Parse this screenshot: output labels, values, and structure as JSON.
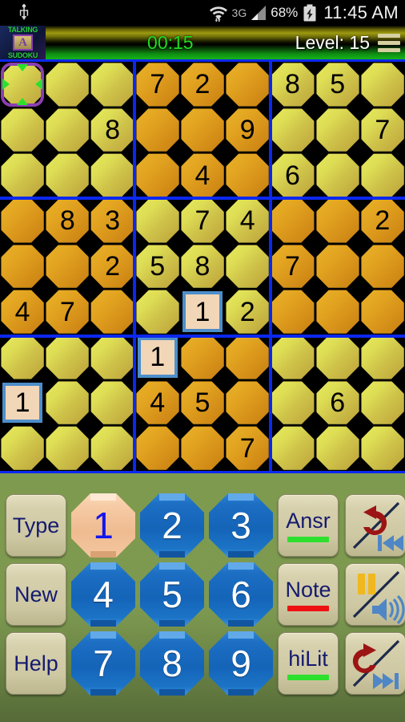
{
  "status_bar": {
    "usb_icon": "usb-icon",
    "wifi_icon": "wifi-icon",
    "network": "3G",
    "signal_icon": "signal-bars-icon",
    "battery_percent": "68%",
    "battery_icon": "battery-charging-icon",
    "clock": "11:45 AM"
  },
  "header": {
    "logo_top": "TALKING",
    "logo_letter": "A",
    "logo_bottom": "SUDOKU",
    "timer": "00:15",
    "level": "Level: 15",
    "menu_icon": "hamburger-menu-icon",
    "timer_color": "#1fdd1f",
    "level_color": "#ffffff"
  },
  "board": {
    "grid_line_color": "#0b28f0",
    "cell_light_color": "#dede55",
    "cell_dark_color": "#e3a521",
    "user_value_fill": "#f2d6b8",
    "user_value_border": "#4d8ecb",
    "cursor_border_color": "#8a3fb0",
    "cursor_arrow_color": "#2ce02c",
    "cursor_row": 0,
    "cursor_col": 0,
    "rows": [
      [
        {
          "v": "",
          "t": "empty"
        },
        {
          "v": "",
          "t": "empty"
        },
        {
          "v": "",
          "t": "empty"
        },
        {
          "v": "7",
          "t": "given"
        },
        {
          "v": "2",
          "t": "given"
        },
        {
          "v": "",
          "t": "empty"
        },
        {
          "v": "8",
          "t": "given"
        },
        {
          "v": "5",
          "t": "given"
        },
        {
          "v": "",
          "t": "empty"
        }
      ],
      [
        {
          "v": "",
          "t": "empty"
        },
        {
          "v": "",
          "t": "empty"
        },
        {
          "v": "8",
          "t": "given"
        },
        {
          "v": "",
          "t": "empty"
        },
        {
          "v": "",
          "t": "empty"
        },
        {
          "v": "9",
          "t": "given"
        },
        {
          "v": "",
          "t": "empty"
        },
        {
          "v": "",
          "t": "empty"
        },
        {
          "v": "7",
          "t": "given"
        }
      ],
      [
        {
          "v": "",
          "t": "empty"
        },
        {
          "v": "",
          "t": "empty"
        },
        {
          "v": "",
          "t": "empty"
        },
        {
          "v": "",
          "t": "empty"
        },
        {
          "v": "4",
          "t": "given"
        },
        {
          "v": "",
          "t": "empty"
        },
        {
          "v": "6",
          "t": "given"
        },
        {
          "v": "",
          "t": "empty"
        },
        {
          "v": "",
          "t": "empty"
        }
      ],
      [
        {
          "v": "",
          "t": "empty"
        },
        {
          "v": "8",
          "t": "given"
        },
        {
          "v": "3",
          "t": "given"
        },
        {
          "v": "",
          "t": "empty"
        },
        {
          "v": "7",
          "t": "given"
        },
        {
          "v": "4",
          "t": "given"
        },
        {
          "v": "",
          "t": "empty"
        },
        {
          "v": "",
          "t": "empty"
        },
        {
          "v": "2",
          "t": "given"
        }
      ],
      [
        {
          "v": "",
          "t": "empty"
        },
        {
          "v": "",
          "t": "empty"
        },
        {
          "v": "2",
          "t": "given"
        },
        {
          "v": "5",
          "t": "given"
        },
        {
          "v": "8",
          "t": "given"
        },
        {
          "v": "",
          "t": "empty"
        },
        {
          "v": "7",
          "t": "given"
        },
        {
          "v": "",
          "t": "empty"
        },
        {
          "v": "",
          "t": "empty"
        }
      ],
      [
        {
          "v": "4",
          "t": "given"
        },
        {
          "v": "7",
          "t": "given"
        },
        {
          "v": "",
          "t": "empty"
        },
        {
          "v": "",
          "t": "empty"
        },
        {
          "v": "1",
          "t": "user"
        },
        {
          "v": "2",
          "t": "given"
        },
        {
          "v": "",
          "t": "empty"
        },
        {
          "v": "",
          "t": "empty"
        },
        {
          "v": "",
          "t": "empty"
        }
      ],
      [
        {
          "v": "",
          "t": "empty"
        },
        {
          "v": "",
          "t": "empty"
        },
        {
          "v": "",
          "t": "empty"
        },
        {
          "v": "1",
          "t": "user"
        },
        {
          "v": "",
          "t": "empty"
        },
        {
          "v": "",
          "t": "empty"
        },
        {
          "v": "",
          "t": "empty"
        },
        {
          "v": "",
          "t": "empty"
        },
        {
          "v": "",
          "t": "empty"
        }
      ],
      [
        {
          "v": "1",
          "t": "user"
        },
        {
          "v": "",
          "t": "empty"
        },
        {
          "v": "",
          "t": "empty"
        },
        {
          "v": "4",
          "t": "given"
        },
        {
          "v": "5",
          "t": "given"
        },
        {
          "v": "",
          "t": "empty"
        },
        {
          "v": "",
          "t": "empty"
        },
        {
          "v": "6",
          "t": "given"
        },
        {
          "v": "",
          "t": "empty"
        }
      ],
      [
        {
          "v": "",
          "t": "empty"
        },
        {
          "v": "",
          "t": "empty"
        },
        {
          "v": "",
          "t": "empty"
        },
        {
          "v": "",
          "t": "empty"
        },
        {
          "v": "",
          "t": "empty"
        },
        {
          "v": "7",
          "t": "given"
        },
        {
          "v": "",
          "t": "empty"
        },
        {
          "v": "",
          "t": "empty"
        },
        {
          "v": "",
          "t": "empty"
        }
      ]
    ]
  },
  "panel": {
    "background_color": "#7d9950",
    "function_buttons": [
      {
        "label": "Type",
        "bar": null
      },
      {
        "label": "New",
        "bar": null
      },
      {
        "label": "Help",
        "bar": null
      }
    ],
    "mode_buttons": [
      {
        "label": "Ansr",
        "bar_color": "#2de02d"
      },
      {
        "label": "Note",
        "bar_color": "#ee1111"
      },
      {
        "label": "hiLit",
        "bar_color": "#2de02d"
      }
    ],
    "number_buttons": [
      {
        "label": "1",
        "selected": true
      },
      {
        "label": "2",
        "selected": false
      },
      {
        "label": "3",
        "selected": false
      },
      {
        "label": "4",
        "selected": false
      },
      {
        "label": "5",
        "selected": false
      },
      {
        "label": "6",
        "selected": false
      },
      {
        "label": "7",
        "selected": false
      },
      {
        "label": "8",
        "selected": false
      },
      {
        "label": "9",
        "selected": false
      }
    ],
    "icon_buttons": [
      {
        "name": "undo-skip-back-icon",
        "primary": "undo-arrow",
        "secondary": "skip-to-start"
      },
      {
        "name": "pause-mute-icon",
        "primary": "pause-bars",
        "secondary": "speaker-volume"
      },
      {
        "name": "redo-skip-forward-icon",
        "primary": "redo-arrow",
        "secondary": "skip-to-end"
      }
    ],
    "selected_number_fill": "#f6cba5",
    "selected_number_text": "#1414ee",
    "number_button_fill": "#1d6fc4"
  }
}
